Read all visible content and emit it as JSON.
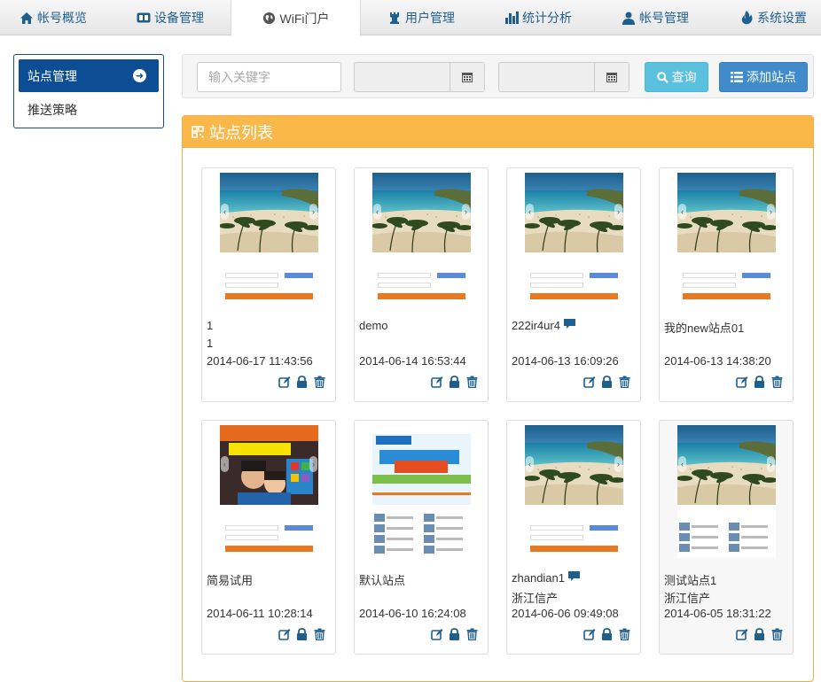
{
  "nav": {
    "tabs": [
      {
        "label": "帐号概览",
        "icon": "home-icon"
      },
      {
        "label": "设备管理",
        "icon": "device-icon"
      },
      {
        "label": "WiFi门户",
        "icon": "globe-icon"
      },
      {
        "label": "用户管理",
        "icon": "users-icon"
      },
      {
        "label": "统计分析",
        "icon": "bar-chart-icon"
      },
      {
        "label": "帐号管理",
        "icon": "user-icon"
      },
      {
        "label": "系统设置",
        "icon": "flame-icon"
      }
    ],
    "active": "WiFi门户"
  },
  "sidebar": {
    "items": [
      {
        "label": "站点管理",
        "active": true,
        "icon": "arrow-right-circle-icon"
      },
      {
        "label": "推送策略",
        "active": false
      }
    ]
  },
  "toolbar": {
    "keyword_placeholder": "输入关键字",
    "keyword_value": "",
    "start_date": "",
    "end_date": "",
    "search_label": "查询",
    "add_label": "添加站点"
  },
  "panel": {
    "title": "站点列表"
  },
  "sites": [
    {
      "name": "1",
      "sub": "1",
      "time": "2014-06-17 11:43:56",
      "comment": false,
      "thumb": "beach"
    },
    {
      "name": "demo",
      "sub": "",
      "time": "2014-06-14 16:53:44",
      "comment": false,
      "thumb": "beach"
    },
    {
      "name": "222ir4ur4",
      "sub": "",
      "time": "2014-06-13 16:09:26",
      "comment": true,
      "thumb": "beach"
    },
    {
      "name": "我的new站点01",
      "sub": "",
      "time": "2014-06-13 14:38:20",
      "comment": false,
      "thumb": "beach"
    },
    {
      "name": "简易试用",
      "sub": "",
      "time": "2014-06-11 10:28:14",
      "comment": false,
      "thumb": "ad-people"
    },
    {
      "name": "默认站点",
      "sub": "",
      "time": "2014-06-10 16:24:08",
      "comment": false,
      "thumb": "ad-100m"
    },
    {
      "name": "zhandian1",
      "sub": "浙江信产",
      "time": "2014-06-06 09:49:08",
      "comment": true,
      "thumb": "beach"
    },
    {
      "name": "测试站点1",
      "sub": "浙江信产",
      "time": "2014-06-05 18:31:22",
      "comment": false,
      "thumb": "beach-grid",
      "highlight": true
    }
  ],
  "card_actions": [
    "edit-icon",
    "lock-icon",
    "trash-icon"
  ],
  "colors": {
    "nav_text": "#1f5f8e",
    "sidebar_active": "#0c4d93",
    "search_button": "#5bc0de",
    "add_button": "#428bca",
    "panel_header": "#fbb84a",
    "action_icon": "#1f5f8e"
  }
}
